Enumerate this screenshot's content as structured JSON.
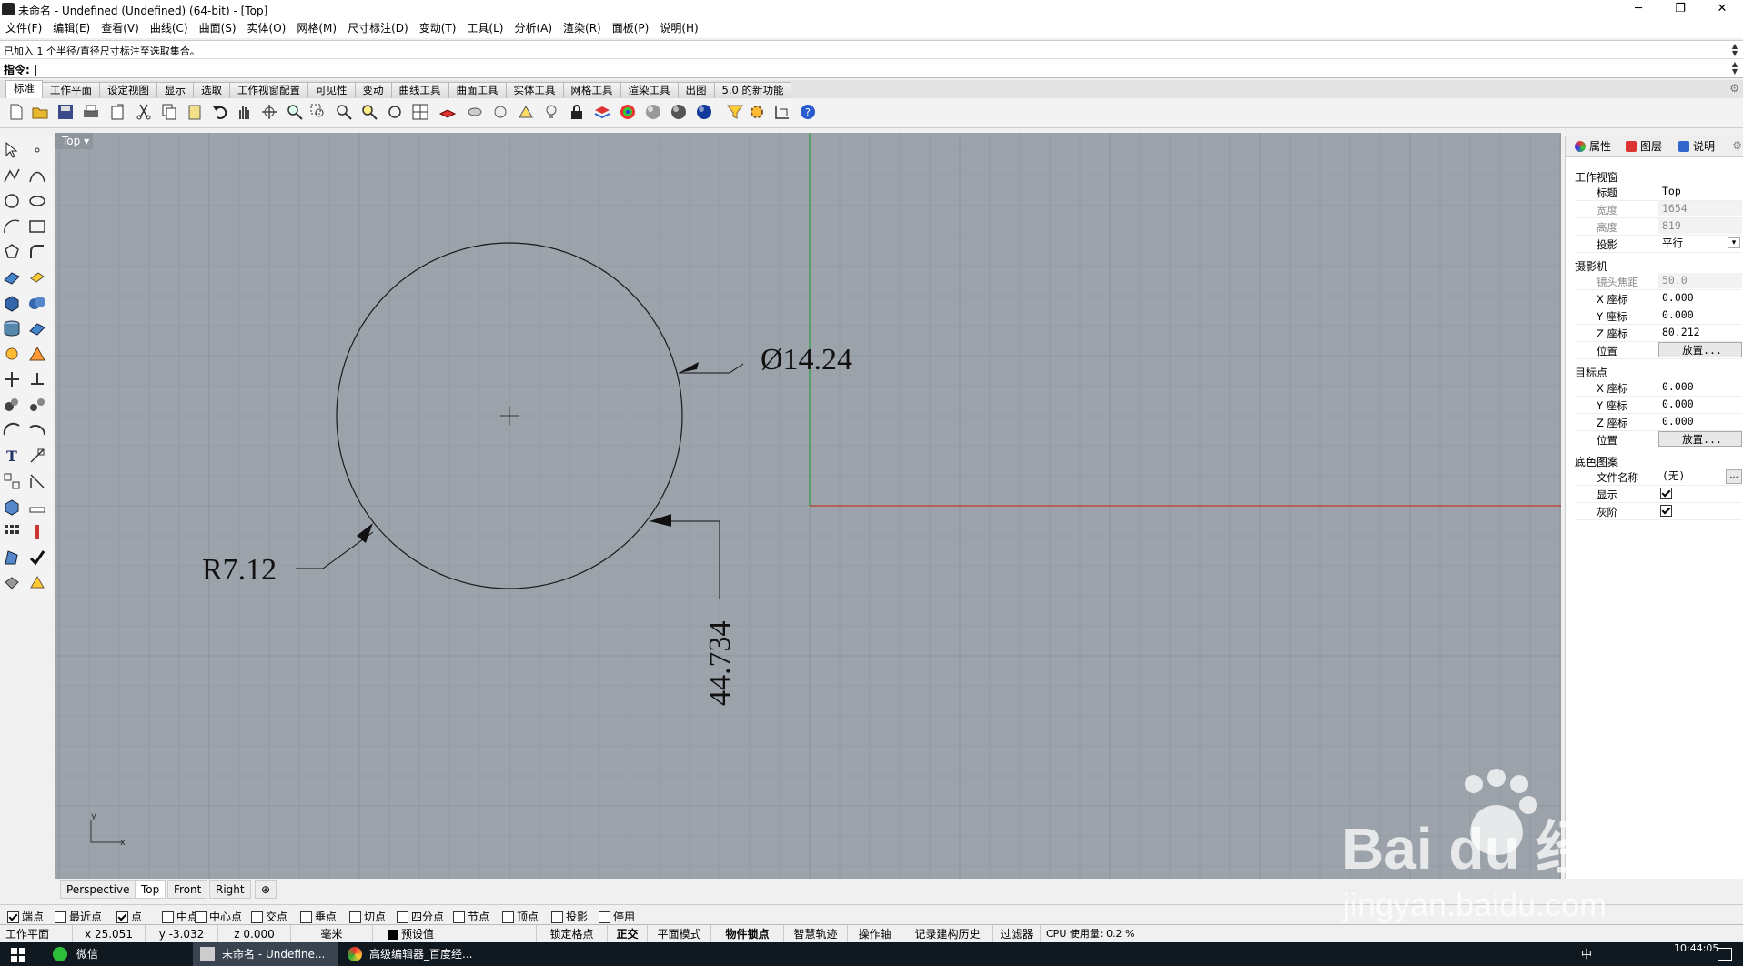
{
  "window": {
    "title": "未命名 - Undefined (Undefined) (64-bit) - [Top]",
    "minimize": "─",
    "restore": "❐",
    "close": "✕"
  },
  "menu": [
    "文件(F)",
    "编辑(E)",
    "查看(V)",
    "曲线(C)",
    "曲面(S)",
    "实体(O)",
    "网格(M)",
    "尺寸标注(D)",
    "变动(T)",
    "工具(L)",
    "分析(A)",
    "渲染(R)",
    "面板(P)",
    "说明(H)"
  ],
  "command": {
    "history": "已加入 1 个半径/直径尺寸标注至选取集合。",
    "prompt": "指令: |"
  },
  "toolbar_tabs": [
    "标准",
    "工作平面",
    "设定视图",
    "显示",
    "选取",
    "工作视窗配置",
    "可见性",
    "变动",
    "曲线工具",
    "曲面工具",
    "实体工具",
    "网格工具",
    "渲染工具",
    "出图",
    "5.0 的新功能"
  ],
  "viewport": {
    "name": "Top",
    "dim_diameter": "Ø14.24",
    "dim_radius": "R7.12",
    "dim_vertical": "44.734",
    "axis_x": "x",
    "axis_y": "y",
    "colors": {
      "background": "#9ca3ab",
      "grid": "#8d949c",
      "x_axis": "#c0392b",
      "y_axis": "#27ae60"
    }
  },
  "viewport_tabs": [
    "Perspective",
    "Top",
    "Front",
    "Right",
    "⊕"
  ],
  "right_panel": {
    "tabs": [
      "属性",
      "图层",
      "说明"
    ],
    "sections": {
      "viewport": "工作视窗",
      "camera": "摄影机",
      "target": "目标点",
      "wallpaper": "底色图案"
    },
    "props": {
      "title_k": "标题",
      "title_v": "Top",
      "width_k": "宽度",
      "width_v": "1654",
      "height_k": "高度",
      "height_v": "819",
      "proj_k": "投影",
      "proj_v": "平行",
      "lens_k": "镜头焦距",
      "lens_v": "50.0",
      "cx_k": "X 座标",
      "cx_v": "0.000",
      "cy_k": "Y 座标",
      "cy_v": "0.000",
      "cz_k": "Z 座标",
      "cz_v": "80.212",
      "cpos_k": "位置",
      "cpos_v": "放置...",
      "tx_k": "X 座标",
      "tx_v": "0.000",
      "ty_k": "Y 座标",
      "ty_v": "0.000",
      "tz_k": "Z 座标",
      "tz_v": "0.000",
      "tpos_k": "位置",
      "tpos_v": "放置...",
      "file_k": "文件名称",
      "file_v": "(无)",
      "show_k": "显示",
      "gray_k": "灰阶"
    }
  },
  "osnaps": [
    {
      "label": "端点",
      "on": true
    },
    {
      "label": "最近点",
      "on": false
    },
    {
      "label": "点",
      "on": true
    },
    {
      "label": "中点",
      "on": false
    },
    {
      "label": "中心点",
      "on": false
    },
    {
      "label": "交点",
      "on": false
    },
    {
      "label": "垂点",
      "on": false
    },
    {
      "label": "切点",
      "on": false
    },
    {
      "label": "四分点",
      "on": false
    },
    {
      "label": "节点",
      "on": false
    },
    {
      "label": "顶点",
      "on": false
    },
    {
      "label": "投影",
      "on": false
    },
    {
      "label": "停用",
      "on": false
    }
  ],
  "status": {
    "plane": "工作平面",
    "x": "x 25.051",
    "y": "y -3.032",
    "z": "z 0.000",
    "units": "毫米",
    "layer": "预设值",
    "grid_snap": "锁定格点",
    "ortho": "正交",
    "planar": "平面模式",
    "osnap": "物件锁点",
    "smarttrack": "智慧轨迹",
    "gumball": "操作轴",
    "history": "记录建构历史",
    "filter": "过滤器",
    "cpu": "CPU 使用量: 0.2 %"
  },
  "taskbar": {
    "app1": "微信",
    "app2": "未命名 - Undefine...",
    "app3": "高级编辑器_百度经...",
    "time": "10:44:05",
    "ime": "中"
  },
  "watermark": {
    "brand": "Bai du 经验",
    "url": "jingyan.baidu.com"
  }
}
